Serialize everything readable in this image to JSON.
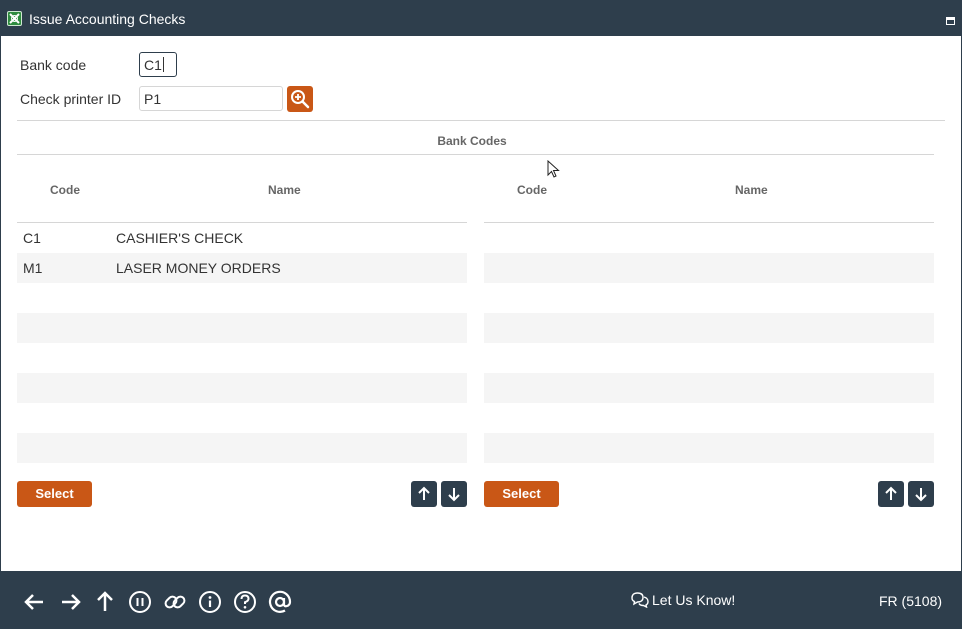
{
  "window": {
    "title": "Issue Accounting Checks"
  },
  "form": {
    "bank_code_label": "Bank code",
    "bank_code_value": "C1",
    "printer_label": "Check printer ID",
    "printer_value": "P1"
  },
  "section": {
    "title": "Bank Codes"
  },
  "left_grid": {
    "headers": {
      "code": "Code",
      "name": "Name"
    },
    "rows": [
      {
        "code": "C1",
        "name": "CASHIER'S CHECK"
      },
      {
        "code": "M1",
        "name": "LASER MONEY ORDERS"
      }
    ],
    "select_label": "Select"
  },
  "right_grid": {
    "headers": {
      "code": "Code",
      "name": "Name"
    },
    "rows": [],
    "select_label": "Select"
  },
  "footer": {
    "let_us_know": "Let Us Know!",
    "code": "FR (5108)",
    "icons": [
      "back-arrow-icon",
      "forward-arrow-icon",
      "up-arrow-icon",
      "pause-icon",
      "link-icon",
      "info-icon",
      "help-icon",
      "at-icon"
    ]
  },
  "colors": {
    "primary_dark": "#2e3e4c",
    "accent_orange": "#c95716",
    "alt_row": "#f5f5f5"
  }
}
